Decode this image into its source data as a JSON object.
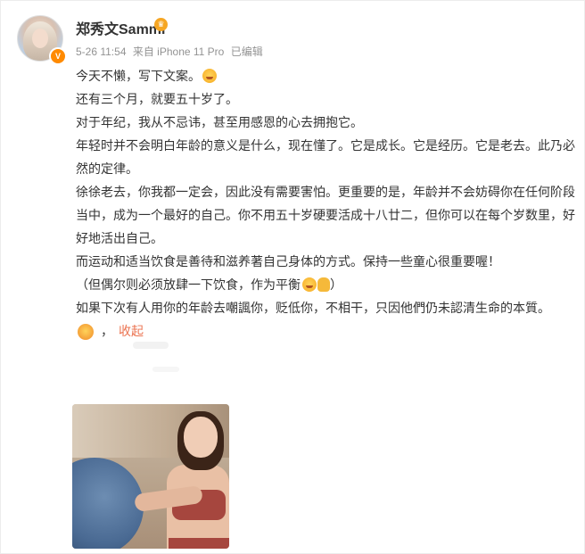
{
  "post": {
    "username": "郑秀文Sammi",
    "meta": {
      "datetime": "5-26 11:54",
      "source": "来自 iPhone 11 Pro",
      "edited": "已编辑"
    },
    "lines": [
      "今天不懒，写下文案。",
      "还有三个月，就要五十岁了。",
      "对于年纪，我从不忌讳，甚至用感恩的心去拥抱它。",
      "年轻时并不会明白年龄的意义是什么，现在懂了。它是成长。它是经历。它是老去。此乃必然的定律。",
      "徐徐老去，你我都一定会，因此没有需要害怕。更重要的是，年龄并不会妨碍你在任何阶段当中，成为一个最好的自己。你不用五十岁硬要活成十八廿二，但你可以在每个岁数里，好好地活出自己。",
      "而运动和适当饮食是善待和滋养著自己身体的方式。保持一些童心很重要喔！",
      "（但偶尔则必须放肆一下饮食，作为平衡",
      "）",
      "如果下次有人用你的年龄去嘲諷你，贬低你，不相干，只因他們仍未認清生命的本質。"
    ],
    "collapse_label": "收起",
    "separator": "，"
  },
  "icons": {
    "verified": "verified-badge-icon",
    "crown": "crown-icon",
    "grin": "grinning-face-icon",
    "smile": "smiling-face-icon",
    "ok_hand": "ok-hand-icon",
    "hug": "hugging-face-icon"
  },
  "colors": {
    "link": "#eb7350",
    "meta": "#939393",
    "text": "#333333",
    "badge": "#ff8a00"
  }
}
